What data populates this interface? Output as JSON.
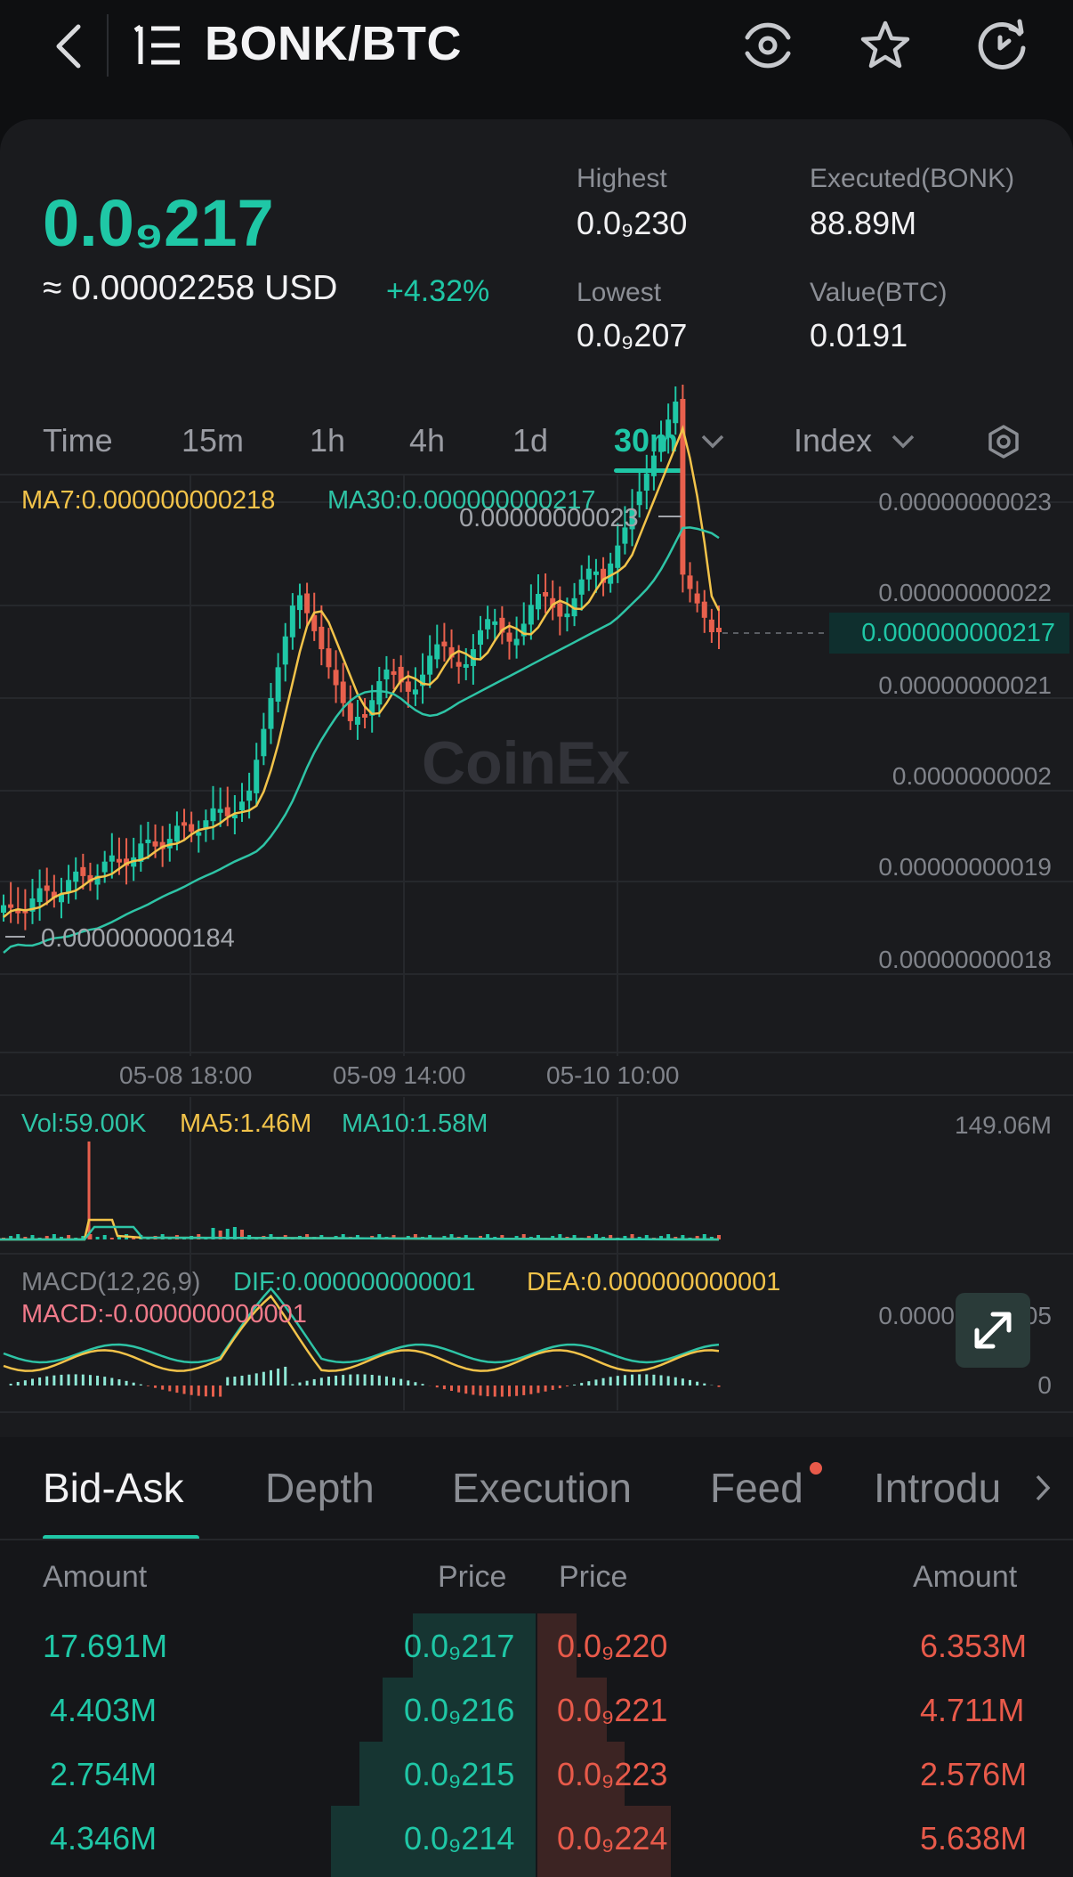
{
  "header": {
    "title": "BONK/BTC",
    "icons": [
      "back-arrow-icon",
      "market-list-icon",
      "eye-watch-icon",
      "star-icon",
      "refresh-icon"
    ]
  },
  "ticker": {
    "last_price": "0.0₉217",
    "usd_equiv": "≈ 0.00002258 USD",
    "change": "+4.32%",
    "highest_label": "Highest",
    "highest": "0.0₉230",
    "lowest_label": "Lowest",
    "lowest": "0.0₉207",
    "executed_label": "Executed(BONK)",
    "executed": "88.89M",
    "value_label": "Value(BTC)",
    "value": "0.0191"
  },
  "timeframes": {
    "items": [
      "Time",
      "15m",
      "1h",
      "4h",
      "1d"
    ],
    "active": "30m",
    "index_label": "Index"
  },
  "chart": {
    "ma7": "MA7:0.000000000218",
    "ma30": "MA30:0.000000000217",
    "max_annotation": "0.00000000023",
    "min_annotation": "0.000000000184",
    "current_price_tag": "0.000000000217",
    "watermark": "CoinEx",
    "y_labels": [
      "0.00000000023",
      "0.00000000022",
      "0.00000000021",
      "0.0000000002",
      "0.00000000019",
      "0.00000000018"
    ],
    "x_labels": [
      "05-08 18:00",
      "05-09 14:00",
      "05-10 10:00"
    ],
    "vol": "Vol:59.00K",
    "ma5": "MA5:1.46M",
    "ma10": "MA10:1.58M",
    "vol_max": "149.06M",
    "macd_title": "MACD(12,26,9)",
    "dif": "DIF:0.000000000001",
    "dea": "DEA:0.000000000001",
    "macd": "MACD:-0.000000000001",
    "macd_ylabel_top": "0.00000000005",
    "macd_ylabel_bottom": "0",
    "colors": {
      "up": "#1fc7a6",
      "down": "#e8604d",
      "ma7": "#f2c34a",
      "ma30": "#2ec4a6"
    }
  },
  "bottom_tabs": [
    "Bid-Ask",
    "Depth",
    "Execution",
    "Feed",
    "Introdu"
  ],
  "orderbook": {
    "headers": {
      "bid_amount": "Amount",
      "bid_price": "Price",
      "ask_price": "Price",
      "ask_amount": "Amount"
    },
    "rows": [
      {
        "bid_amount": "17.691M",
        "bid_price": "0.0₉217",
        "ask_price": "0.0₉220",
        "ask_amount": "6.353M"
      },
      {
        "bid_amount": "4.403M",
        "bid_price": "0.0₉216",
        "ask_price": "0.0₉221",
        "ask_amount": "4.711M"
      },
      {
        "bid_amount": "2.754M",
        "bid_price": "0.0₉215",
        "ask_price": "0.0₉223",
        "ask_amount": "2.576M"
      },
      {
        "bid_amount": "4.346M",
        "bid_price": "0.0₉214",
        "ask_price": "0.0₉224",
        "ask_amount": "5.638M"
      }
    ]
  }
}
